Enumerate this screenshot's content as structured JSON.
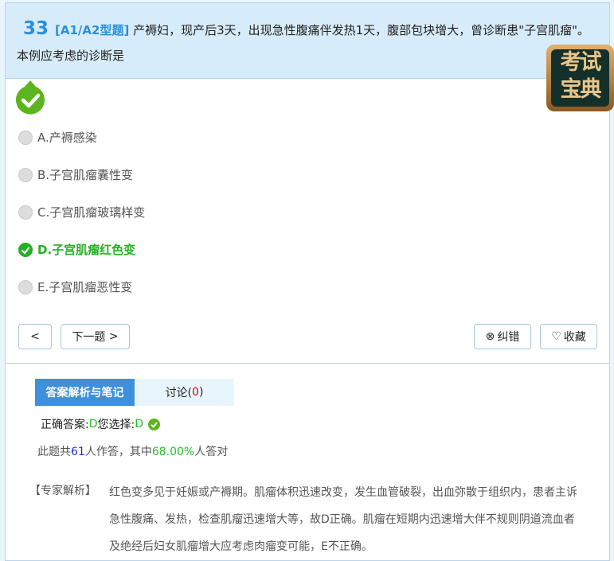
{
  "question": {
    "number": "33",
    "type": "[A1/A2型题]",
    "text": "产褥妇，现产后3天，出现急性腹痛伴发热1天，腹部包块增大，曾诊断患\"子宫肌瘤\"。本例应考虑的诊断是"
  },
  "logo": {
    "text": "考试宝典"
  },
  "options": [
    {
      "label": "A.产褥感染",
      "state": "unselected"
    },
    {
      "label": "B.子宫肌瘤囊性变",
      "state": "unselected"
    },
    {
      "label": "C.子宫肌瘤玻璃样变",
      "state": "unselected"
    },
    {
      "label": "D.子宫肌瘤红色变",
      "state": "correct"
    },
    {
      "label": "E.子宫肌瘤恶性变",
      "state": "unselected"
    }
  ],
  "nav": {
    "prev_icon": "<",
    "next_label": "下一题",
    "next_icon": ">",
    "report_label": "纠错",
    "favorite_label": "收藏"
  },
  "tabs": {
    "analysis": "答案解析与笔记",
    "discussion": "讨论(",
    "discussion_count": "0",
    "discussion_close": ")"
  },
  "answer": {
    "correct_label": "正确答案: ",
    "correct_value": "D",
    "chosen_label": "您选择: ",
    "chosen_value": "D"
  },
  "stats": {
    "prefix": "此题共",
    "count": "61",
    "middle": "人作答，其中",
    "rate": "68.00%",
    "suffix": "人答对"
  },
  "explanation": {
    "label": "【专家解析】",
    "text": "红色变多见于妊娠或产褥期。肌瘤体积迅速改变，发生血管破裂，出血弥散于组织内，患者主诉急性腹痛、发热，检查肌瘤迅速增大等，故D正确。肌瘤在短期内迅速增大伴不规则阴道流血者及绝经后妇女肌瘤增大应考虑肉瘤变可能，E不正确。"
  },
  "colors": {
    "accent": "#2a8fd8",
    "correct": "#24b024",
    "tab_active": "#3e8fdc"
  }
}
